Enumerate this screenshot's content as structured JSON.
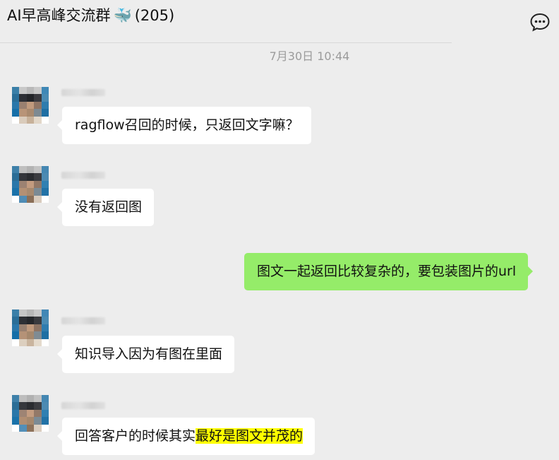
{
  "header": {
    "title": "AI早高峰交流群",
    "emoji": "🐳",
    "member_count": "(205)",
    "more_icon": "chat-bubble-dots-icon"
  },
  "timestamp": "7月30日 10:44",
  "messages": [
    {
      "side": "left",
      "text": "ragflow召回的时候，只返回文字嘛？"
    },
    {
      "side": "left",
      "text": "没有返回图"
    },
    {
      "side": "right",
      "text": "图文一起返回比较复杂的，要包装图片的url"
    },
    {
      "side": "left",
      "text": "知识导入因为有图在里面"
    },
    {
      "side": "left",
      "text": "回答客户的时候其实",
      "highlight": "最好是图文并茂的",
      "highlight_color": "#ffff00"
    }
  ],
  "colors": {
    "background": "#ededed",
    "incoming_bubble": "#ffffff",
    "outgoing_bubble": "#95ec69"
  }
}
